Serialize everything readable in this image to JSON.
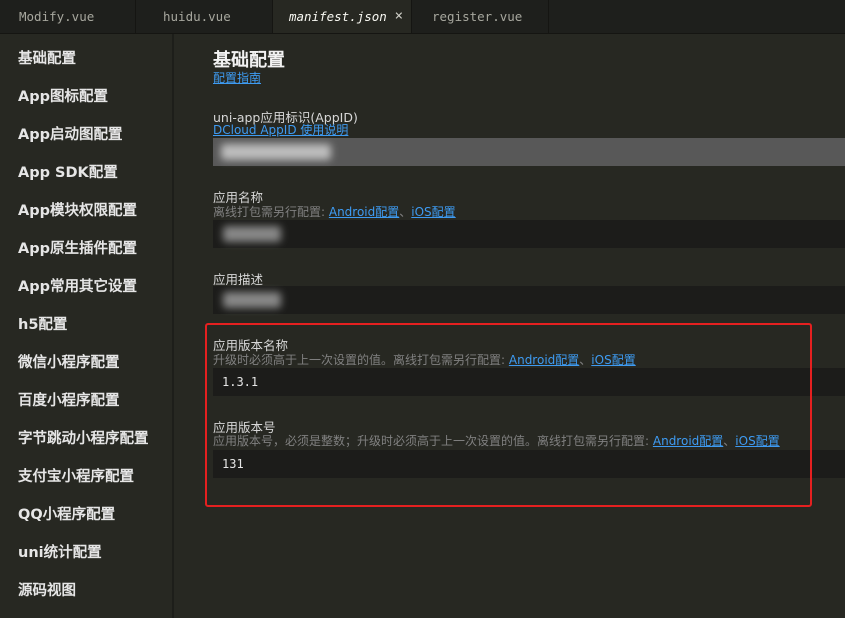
{
  "tabs": [
    {
      "label": "Modify.vue"
    },
    {
      "label": "huidu.vue"
    },
    {
      "label": "manifest.json",
      "close": "×"
    },
    {
      "label": "register.vue"
    }
  ],
  "sidebar": {
    "items": [
      {
        "label": "基础配置"
      },
      {
        "label": "App图标配置"
      },
      {
        "label": "App启动图配置"
      },
      {
        "label": "App SDK配置"
      },
      {
        "label": "App模块权限配置"
      },
      {
        "label": "App原生插件配置"
      },
      {
        "label": "App常用其它设置"
      },
      {
        "label": "h5配置"
      },
      {
        "label": "微信小程序配置"
      },
      {
        "label": "百度小程序配置"
      },
      {
        "label": "字节跳动小程序配置"
      },
      {
        "label": "支付宝小程序配置"
      },
      {
        "label": "QQ小程序配置"
      },
      {
        "label": "uni统计配置"
      },
      {
        "label": "源码视图"
      }
    ]
  },
  "main": {
    "title": "基础配置",
    "guide_link": "配置指南",
    "appid": {
      "label": "uni-app应用标识(AppID)",
      "help_link": "DCloud AppID 使用说明"
    },
    "app_name": {
      "label": "应用名称",
      "hint_prefix": "离线打包需另行配置: ",
      "android_link": "Android配置",
      "sep": "、",
      "ios_link": "iOS配置"
    },
    "app_desc": {
      "label": "应用描述"
    },
    "version_name": {
      "label": "应用版本名称",
      "hint_prefix": "升级时必须高于上一次设置的值。离线打包需另行配置: ",
      "android_link": "Android配置",
      "sep": "、",
      "ios_link": "iOS配置",
      "value": "1.3.1"
    },
    "version_code": {
      "label": "应用版本号",
      "hint_prefix": "应用版本号，必须是整数；升级时必须高于上一次设置的值。离线打包需另行配置: ",
      "android_link": "Android配置",
      "sep": "、",
      "ios_link": "iOS配置",
      "value": "131"
    }
  },
  "colors": {
    "highlight_border": "#e52020",
    "link": "#3e9bf2",
    "background": "#272822"
  }
}
